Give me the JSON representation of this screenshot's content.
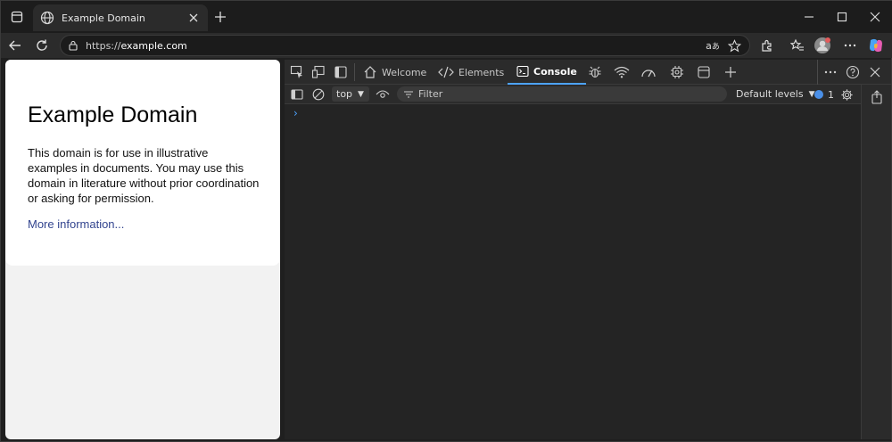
{
  "browser": {
    "tab_title": "Example Domain",
    "url_prefix": "https://",
    "url_host": "example.com"
  },
  "page": {
    "heading": "Example Domain",
    "paragraph": "This domain is for use in illustrative examples in documents. You may use this domain in literature without prior coordination or asking for permission.",
    "link": "More information..."
  },
  "devtools": {
    "tabs": [
      {
        "label": "Welcome",
        "icon": "home-icon"
      },
      {
        "label": "Elements",
        "icon": "code-icon"
      },
      {
        "label": "Console",
        "icon": "console-icon",
        "active": true
      }
    ],
    "context": "top",
    "filter_placeholder": "Filter",
    "levels": "Default levels",
    "issues_count": "1",
    "prompt": "›"
  },
  "colors": {
    "accent": "#4da3ff",
    "link": "#33458f",
    "issue": "#4a8fe7"
  }
}
